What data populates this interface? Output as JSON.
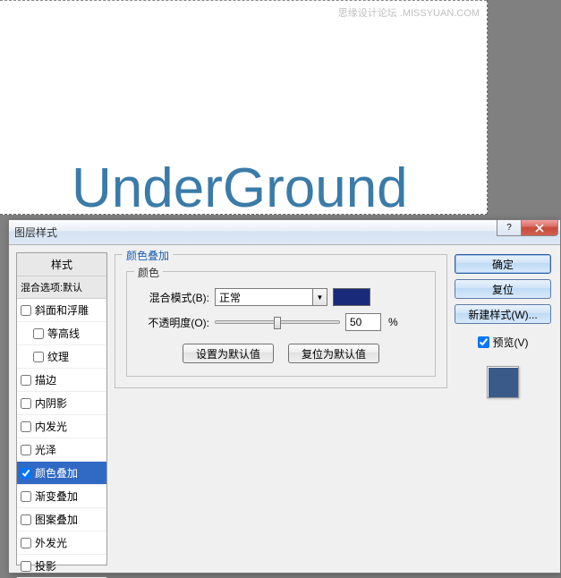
{
  "watermark": "思缘设计论坛  .MISSYUAN.COM",
  "canvas_text": "UnderGround",
  "dialog": {
    "title": "图层样式",
    "styles_header": "样式",
    "blend_options": "混合选项:默认",
    "effects": [
      {
        "label": "斜面和浮雕",
        "checked": false,
        "indent": false
      },
      {
        "label": "等高线",
        "checked": false,
        "indent": true
      },
      {
        "label": "纹理",
        "checked": false,
        "indent": true
      },
      {
        "label": "描边",
        "checked": false,
        "indent": false
      },
      {
        "label": "内阴影",
        "checked": false,
        "indent": false
      },
      {
        "label": "内发光",
        "checked": false,
        "indent": false
      },
      {
        "label": "光泽",
        "checked": false,
        "indent": false
      },
      {
        "label": "颜色叠加",
        "checked": true,
        "indent": false,
        "selected": true
      },
      {
        "label": "渐变叠加",
        "checked": false,
        "indent": false
      },
      {
        "label": "图案叠加",
        "checked": false,
        "indent": false
      },
      {
        "label": "外发光",
        "checked": false,
        "indent": false
      },
      {
        "label": "投影",
        "checked": false,
        "indent": false
      }
    ],
    "section_title": "颜色叠加",
    "inner_title": "颜色",
    "blend_mode_label": "混合模式(B):",
    "blend_mode_value": "正常",
    "opacity_label": "不透明度(O):",
    "opacity_value": "50",
    "opacity_unit": "%",
    "set_default": "设置为默认值",
    "reset_default": "复位为默认值",
    "overlay_color": "#1a2a7a",
    "buttons": {
      "ok": "确定",
      "reset": "复位",
      "new_style": "新建样式(W)...",
      "preview": "预览(V)"
    },
    "preview_color": "#3a5a8a"
  }
}
